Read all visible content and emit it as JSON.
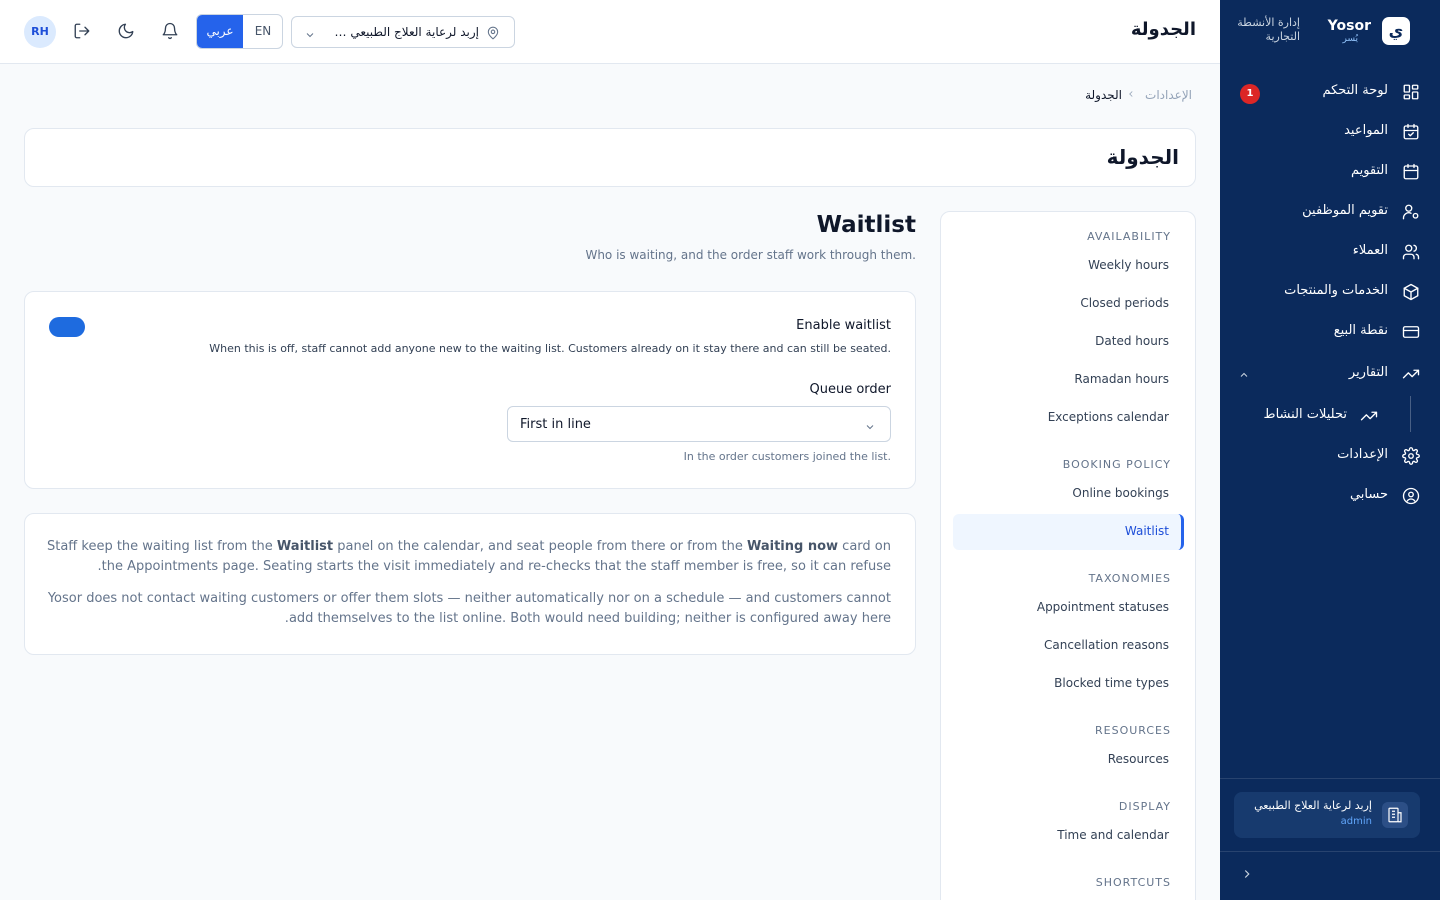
{
  "brand": {
    "name": "Yosor",
    "name_ar": "يُسر",
    "logo_letter": "ي",
    "tagline": "إدارة الأنشطة التجارية"
  },
  "sidebar": {
    "items": [
      {
        "label": "لوحة التحكم",
        "icon": "dashboard-icon",
        "badge": "1"
      },
      {
        "label": "المواعيد",
        "icon": "calendar-check-icon"
      },
      {
        "label": "التقويم",
        "icon": "calendar-icon"
      },
      {
        "label": "تقويم الموظفين",
        "icon": "user-settings-icon"
      },
      {
        "label": "العملاء",
        "icon": "users-icon"
      },
      {
        "label": "الخدمات والمنتجات",
        "icon": "package-icon"
      },
      {
        "label": "نقطة البيع",
        "icon": "credit-card-icon"
      },
      {
        "label": "التقارير",
        "icon": "trending-up-icon",
        "expanded": true
      },
      {
        "label": "الإعدادات",
        "icon": "gear-icon"
      },
      {
        "label": "حسابي",
        "icon": "user-circle-icon"
      }
    ],
    "sub_items": [
      {
        "label": "تحليلات النشاط",
        "icon": "trending-up-icon"
      }
    ],
    "org": {
      "name": "إربد لرعاية العلاج الطبيعي",
      "role": "admin"
    }
  },
  "topbar": {
    "title": "الجدولة",
    "avatar_initials": "RH",
    "lang_ar": "عربي",
    "lang_en": "EN",
    "location": "إربد لرعاية العلاج الطبيعي — ..."
  },
  "breadcrumb": {
    "parent": "الإعدادات",
    "current": "الجدولة"
  },
  "page_title": "الجدولة",
  "settings_menu": {
    "groups": [
      {
        "heading": "AVAILABILITY",
        "items": [
          "Weekly hours",
          "Closed periods",
          "Dated hours",
          "Ramadan hours",
          "Exceptions calendar"
        ]
      },
      {
        "heading": "BOOKING POLICY",
        "items": [
          "Online bookings",
          "Waitlist"
        ]
      },
      {
        "heading": "TAXONOMIES",
        "items": [
          "Appointment statuses",
          "Cancellation reasons",
          "Blocked time types"
        ]
      },
      {
        "heading": "RESOURCES",
        "items": [
          "Resources"
        ]
      },
      {
        "heading": "DISPLAY",
        "items": [
          "Time and calendar"
        ]
      },
      {
        "heading": "SHORTCUTS",
        "items": []
      }
    ],
    "active": "Waitlist"
  },
  "waitlist": {
    "title": "Waitlist",
    "subtitle": "Who is waiting, and the order staff work through them.",
    "enable_label": "Enable waitlist",
    "enable_on": true,
    "enable_help": "When this is off, staff cannot add anyone new to the waiting list. Customers already on it stay there and can still be seated.",
    "queue_label": "Queue order",
    "queue_value": "First in line",
    "queue_help": "In the order customers joined the list.",
    "info_p1_a": "Staff keep the waiting list from the ",
    "info_p1_b": "Waitlist",
    "info_p1_c": " panel on the calendar, and seat people from there or from the ",
    "info_p1_d": "Waiting now",
    "info_p1_e": " card on the Appointments page. Seating starts the visit immediately and re-checks that the staff member is free, so it can refuse.",
    "info_p2": "Yosor does not contact waiting customers or offer them slots — neither automatically nor on a schedule — and customers cannot add themselves to the list online. Both would need building; neither is configured away here.",
    "accent_color": "#1e6bdf"
  }
}
